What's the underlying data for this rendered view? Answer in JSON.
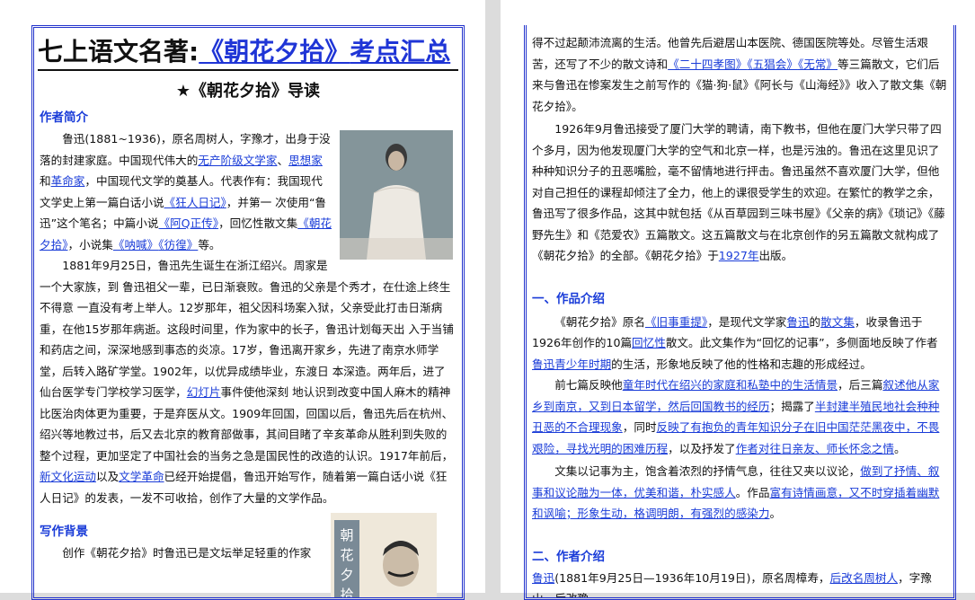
{
  "page1": {
    "title_prefix": "七上语文名著:",
    "title_book": "《朝花夕拾》",
    "title_suffix": "考点汇总",
    "subtitle": "★《朝花夕拾》导读",
    "section_author": "作者简介",
    "para1": [
      {
        "t": "鲁迅(1881~1936)，原名周树人，字豫才，出身于没落的封建家庭。中国现代伟大的"
      },
      {
        "t": "无产阶级文学家",
        "link": true
      },
      {
        "t": "、"
      },
      {
        "t": "思想家",
        "link": true
      },
      {
        "t": "和"
      },
      {
        "t": "革命家",
        "link": true
      },
      {
        "t": "，中国现代文学的奠基人。代表作有：我国现代文学史上第一篇白话小说"
      },
      {
        "t": "《狂人日记》",
        "link": true
      },
      {
        "t": "，并第一 次使用“鲁迅”这个笔名；中篇小说"
      },
      {
        "t": "《阿Q正传》",
        "link": true
      },
      {
        "t": "，回忆性散文集"
      },
      {
        "t": "《朝花夕拾》",
        "link": true
      },
      {
        "t": "，小说集"
      },
      {
        "t": "《呐喊》",
        "link": true
      },
      {
        "t": "《彷徨》",
        "link": true
      },
      {
        "t": "等。"
      }
    ],
    "para2": [
      {
        "t": " 1881年9月25日，鲁迅先生诞生在浙江绍兴。周家是一个大家族，到 鲁迅祖父一辈，已日渐衰败。鲁迅的父亲是个秀才，在仕途上终生不得意 一直没有考上举人。12岁那年，祖父因科场案入狱，父亲受此打击日渐病重，在他15岁那年病逝。这段时间里，作为家中的长子，鲁迅计划每天出 入于当铺和药店之间，深深地感到事态的炎凉。17岁，鲁迅离开家乡，先进了南京水师学堂，后转入路矿学堂。1902年，以优异成绩毕业，东渡日 本深造。两年后，进了仙台医学专门学校学习医学，"
      },
      {
        "t": "幻灯片",
        "link": true
      },
      {
        "t": "事件使他深刻 地认识到改变中国人麻木的精神比医治肉体更为重要，于是弃医从文。1909年回国，回国以后，鲁迅先后在杭州、绍兴等地教过书，后又去北京的教育部做事，其间目睹了辛亥革命从胜利到失败的整个过程，更加坚定了中国社会的当务之急是国民性的改造的认识。1917年前后，"
      },
      {
        "t": "新文化运动",
        "link": true
      },
      {
        "t": "以及"
      },
      {
        "t": "文学革命",
        "link": true
      },
      {
        "t": "已经开始提倡，鲁迅开始写作，随着第一篇白话小说《狂人日记》的发表，一发不可收拾，创作了大量的文学作品。"
      }
    ],
    "section_bg": "写作背景",
    "para3": [
      {
        "t": "创作《朝花夕拾》时鲁迅已是文坛举足轻重的作家"
      }
    ],
    "photo2_text": "朝花夕拾"
  },
  "page2": {
    "para1": [
      {
        "t": "得不过起颠沛流离的生活。他曾先后避居山本医院、德国医院等处。尽管生活艰苦，还写了不少的散文诗和"
      },
      {
        "t": "《二十四孝图》",
        "link": true
      },
      {
        "t": "《五猖会》",
        "link": true
      },
      {
        "t": "《无常》",
        "link": true
      },
      {
        "t": "等三篇散文，它们后来与鲁迅在惨案发生之前写作的《猫·狗·鼠》《阿长与《山海经》》收入了散文集《朝花夕拾》。"
      }
    ],
    "para2": [
      {
        "t": "1926年9月鲁迅接受了厦门大学的聘请，南下教书，但他在厦门大学只带了四个多月，因为他发现厦门大学的空气和北京一样，也是污浊的。鲁迅在这里见识了种种知识分子的丑恶嘴脸，毫不留情地进行抨击。鲁迅虽然不喜欢厦门大学，但他对自己担任的课程却倾注了全力，他上的课很受学生的欢迎。在繁忙的教学之余，鲁迅写了很多作品，这其中就包括《从百草园到三味书屋》《父亲的病》《琐记》《藤野先生》和《范爱农》五篇散文。这五篇散文与在北京创作的另五篇散文就构成了《朝花夕拾》的全部。《朝花夕拾》于"
      },
      {
        "t": "1927年",
        "link": true
      },
      {
        "t": "出版。"
      }
    ],
    "section1": "一、作品介绍",
    "para3": [
      {
        "t": "《朝花夕拾》原名"
      },
      {
        "t": "《旧事重提》",
        "link": true
      },
      {
        "t": "，是现代文学家"
      },
      {
        "t": "鲁迅",
        "link": true
      },
      {
        "t": "的"
      },
      {
        "t": "散文集",
        "link": true
      },
      {
        "t": "，收录鲁迅于1926年创作的10篇"
      },
      {
        "t": "回忆性",
        "link": true
      },
      {
        "t": "散文。此文集作为“回忆的记事”，多侧面地反映了作者"
      },
      {
        "t": "鲁迅青少年时期",
        "link": true
      },
      {
        "t": "的生活，形象地反映了他的性格和志趣的形成经过。"
      }
    ],
    "para4": [
      {
        "t": "前七篇反映他"
      },
      {
        "t": "童年时代在绍兴的家庭和私塾中的生活情景",
        "link": true
      },
      {
        "t": "，后三篇"
      },
      {
        "t": "叙述他从家乡到南京，又到日本留学，然后回国教书的经历",
        "link": true
      },
      {
        "t": "；揭露了"
      },
      {
        "t": "半封建半殖民地社会种种丑恶的不合理现象",
        "link": true
      },
      {
        "t": "，同时"
      },
      {
        "t": "反映了有抱负的青年知识分子在旧中国茫茫黑夜中，不畏艰险，寻找光明的困难历程",
        "link": true
      },
      {
        "t": "，以及抒发了"
      },
      {
        "t": "作者对往日亲友、师长怀念之情",
        "link": true
      },
      {
        "t": "。"
      }
    ],
    "para5": [
      {
        "t": "文集以记事为主，饱含着浓烈的抒情气息，往往又夹以议论，"
      },
      {
        "t": "做到了抒情、叙事和议论融为一体，优美和谐，朴实感人",
        "link": true
      },
      {
        "t": "。作品"
      },
      {
        "t": "富有诗情画意，又不时穿插着幽默和讽喻；形象生动，格调明朗，有强烈的感染力",
        "link": true
      },
      {
        "t": "。"
      }
    ],
    "section2": "二、作者介绍",
    "para6": [
      {
        "t": "鲁迅",
        "link": true
      },
      {
        "t": "(1881年9月25日—1936年10月19日)，原名周樟寿，"
      },
      {
        "t": "后改名周树人",
        "link": true
      },
      {
        "t": "，字豫山，后改豫"
      }
    ]
  }
}
